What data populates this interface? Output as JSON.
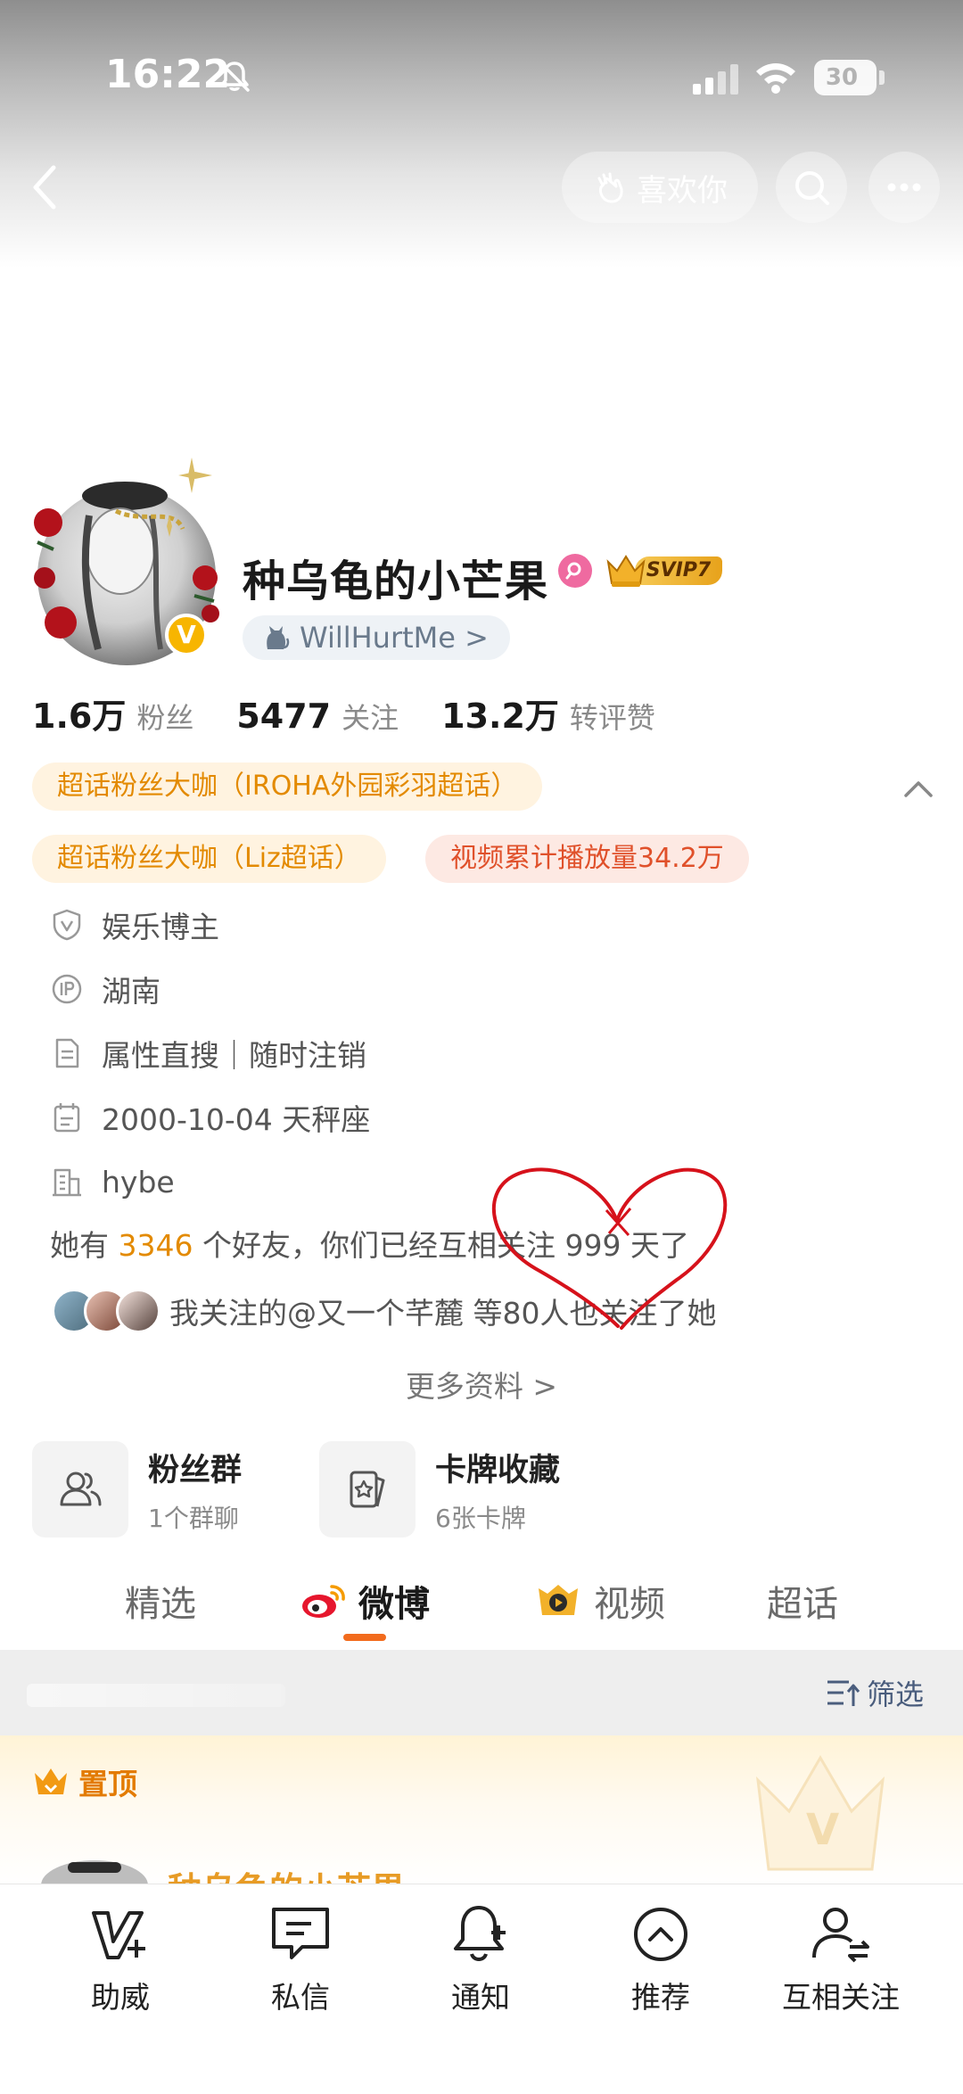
{
  "status_bar": {
    "time": "16:22",
    "battery": "30",
    "icons": [
      "bell-off-icon",
      "signal-icon",
      "wifi-icon",
      "battery-icon"
    ]
  },
  "nav": {
    "like_label": "喜欢你",
    "icons": [
      "back-icon",
      "clap-hand-icon",
      "search-icon",
      "more-icon"
    ]
  },
  "profile": {
    "name": "种乌龟的小芒果",
    "verified_mark": "V",
    "vip_label": "SVIP7",
    "handle": "WillHurtMe >",
    "stats": [
      {
        "value": "1.6万",
        "label": "粉丝"
      },
      {
        "value": "5477",
        "label": "关注"
      },
      {
        "value": "13.2万",
        "label": "转评赞"
      }
    ],
    "tags": [
      "超话粉丝大咖（IROHA外园彩羽超话）",
      "超话粉丝大咖（Liz超话）",
      "视频累计播放量34.2万"
    ],
    "info": [
      {
        "icon": "shield-v-icon",
        "text": "娱乐博主"
      },
      {
        "icon": "ip-icon",
        "text": "湖南"
      },
      {
        "icon": "document-icon",
        "text": "属性直搜｜随时注销"
      },
      {
        "icon": "calendar-icon",
        "text": "2000-10-04 天秤座"
      },
      {
        "icon": "building-icon",
        "text": "hybe"
      }
    ],
    "friends": {
      "prefix": "她有 ",
      "count": "3346",
      "suffix": " 个好友，你们已经互相关注 999 天了"
    },
    "mutual_text": "我关注的@又一个芊麓 等80人也关注了她",
    "more_info": "更多资料 >"
  },
  "features": [
    {
      "icon": "fans-group-icon",
      "title": "粉丝群",
      "subtitle": "1个群聊"
    },
    {
      "icon": "card-collection-icon",
      "title": "卡牌收藏",
      "subtitle": "6张卡牌"
    }
  ],
  "tabs": [
    {
      "label": "精选",
      "active": false
    },
    {
      "label": "微博",
      "active": true,
      "icon": "weibo-icon"
    },
    {
      "label": "视频",
      "active": false,
      "icon": "video-icon"
    },
    {
      "label": "超话",
      "active": false
    }
  ],
  "filter": {
    "label": "筛选"
  },
  "pinned": {
    "label": "置顶",
    "author": "种乌龟的小芒果"
  },
  "bottom_nav": [
    {
      "label": "助威",
      "icon": "cheer-v-icon"
    },
    {
      "label": "私信",
      "icon": "message-icon"
    },
    {
      "label": "通知",
      "icon": "bell-plus-icon"
    },
    {
      "label": "推荐",
      "icon": "chevron-up-circle-icon"
    },
    {
      "label": "互相关注",
      "icon": "mutual-follow-icon"
    }
  ],
  "colors": {
    "accent_orange": "#f26b1d",
    "tag_gold": "#e38a00",
    "tag_red": "#e0512b",
    "heart_doodle": "#d6121b"
  }
}
